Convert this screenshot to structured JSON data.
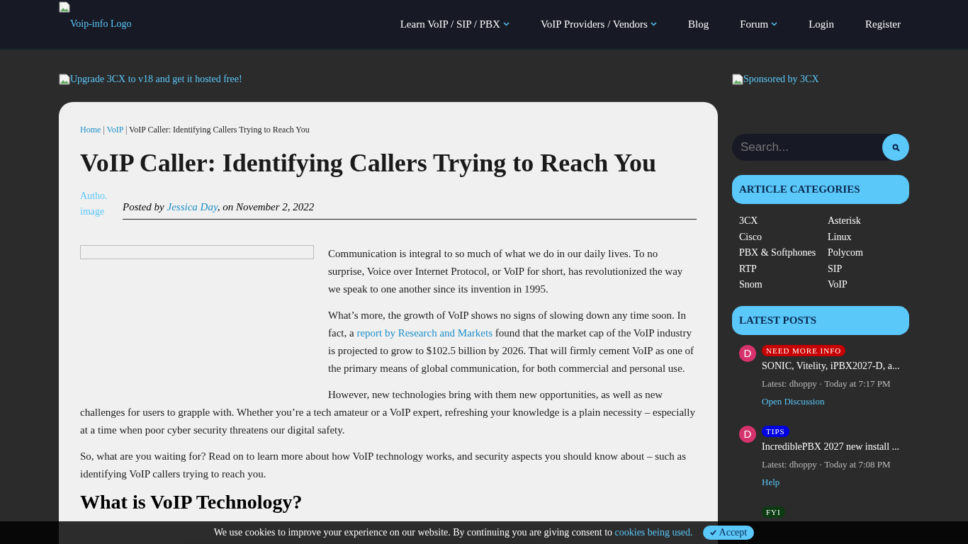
{
  "header": {
    "logo_alt": "Voip-info Logo",
    "nav": [
      {
        "label": "Learn VoIP / SIP / PBX",
        "has_dropdown": true
      },
      {
        "label": "VoIP Providers / Vendors",
        "has_dropdown": true
      },
      {
        "label": "Blog",
        "has_dropdown": false
      },
      {
        "label": "Forum",
        "has_dropdown": true
      },
      {
        "label": "Login",
        "has_dropdown": false
      },
      {
        "label": "Register",
        "has_dropdown": false
      }
    ]
  },
  "banner_alt": "Upgrade 3CX to v18 and get it hosted free!",
  "sponsor_alt": "Sponsored by 3CX",
  "article": {
    "breadcrumb_separator": "|",
    "breadcrumb": [
      {
        "label": "Home",
        "link": true
      },
      {
        "label": "VoIP",
        "link": true
      },
      {
        "label": "VoIP Caller: Identifying Callers Trying to Reach You",
        "link": false
      }
    ],
    "title": "VoIP Caller: Identifying Callers Trying to Reach You",
    "author_image_alt": "Autho. image",
    "posted_prefix": "Posted by",
    "author": "Jessica Day",
    "posted_suffix": ", on November 2, 2022",
    "paragraphs": [
      {
        "parts": [
          {
            "text": "Communication is integral to so much of what we do in our daily lives. To no surprise, Voice over Internet Protocol, or VoIP for short, has revolutionized the way we speak to one another since its invention in 1995.",
            "link": false
          }
        ]
      },
      {
        "parts": [
          {
            "text": "What’s more, the growth of VoIP shows no signs of slowing down any time soon. In fact, a ",
            "link": false
          },
          {
            "text": "report by Research and Markets",
            "link": true
          },
          {
            "text": " found that the market cap of the VoIP industry is projected to grow to $102.5 billion by 2026. That will firmly cement VoIP as one of the primary means of global communication, for both commercial and personal use.",
            "link": false
          }
        ]
      },
      {
        "parts": [
          {
            "text": "However, new technologies bring with them new opportunities, as well as new challenges for users to grapple with. Whether you’re a tech amateur or a VoIP expert, refreshing your knowledge is a plain necessity – especially at a time when poor cyber security threatens our digital safety.",
            "link": false
          }
        ]
      },
      {
        "parts": [
          {
            "text": "So, what are you waiting for? Read on to learn more about how VoIP technology works, and security aspects you should know about – such as identifying VoIP callers trying to reach you.",
            "link": false
          }
        ]
      }
    ],
    "subheading": "What is VoIP Technology?"
  },
  "sidebar": {
    "search": {
      "placeholder": "Search..."
    },
    "categories_title": "ARTICLE CATEGORIES",
    "categories": [
      "3CX",
      "Asterisk",
      "Cisco",
      "Linux",
      "PBX & Softphones",
      "Polycom",
      "RTP",
      "SIP",
      "Snom",
      "VoIP"
    ],
    "latest_title": "LATEST POSTS",
    "posts": [
      {
        "avatar": "D",
        "tag": "NEED MORE INFO",
        "color": "#c80000",
        "title": "SONIC, Vitelity, iPBX2027-D, a...",
        "meta": "Latest: dhoppy · Today at 7:17 PM",
        "forum": "Open Discussion"
      },
      {
        "avatar": "D",
        "tag": "TIPS",
        "color": "#0000e0",
        "title": "IncrediblePBX 2027 new install ...",
        "meta": "Latest: dhoppy · Today at 7:08 PM",
        "forum": "Help"
      },
      {
        "tag": "FYI",
        "color": "#0c3a12"
      }
    ]
  },
  "cookie": {
    "text": "We use cookies to improve your experience on our website. By continuing you are giving consent to ",
    "link": "cookies being used.",
    "accept": "Accept"
  }
}
